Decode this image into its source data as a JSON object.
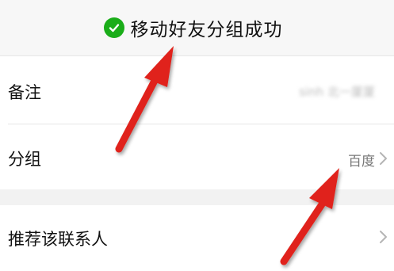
{
  "toast": {
    "text": "移动好友分组成功",
    "icon": "check-circle-icon",
    "icon_color": "#1aad19"
  },
  "rows": {
    "remark": {
      "label": "备注",
      "value": "sinh 北一厦厦"
    },
    "group": {
      "label": "分组",
      "value": "百度"
    },
    "recommend": {
      "label": "推荐该联系人"
    }
  },
  "annotation_color": "#e0241b"
}
